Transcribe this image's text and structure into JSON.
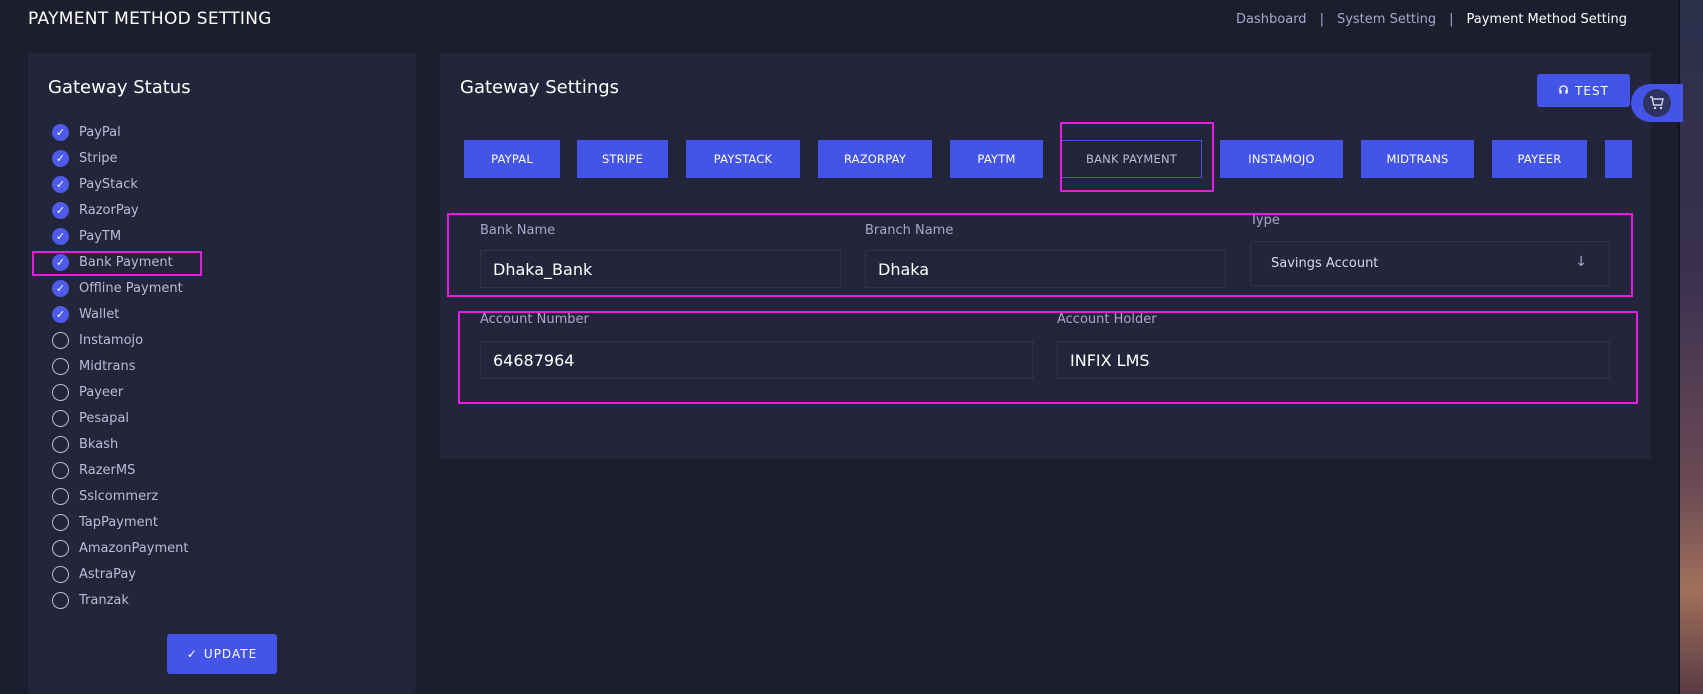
{
  "header": {
    "title": "PAYMENT METHOD SETTING",
    "breadcrumb": [
      "Dashboard",
      "System Setting",
      "Payment Method Setting"
    ],
    "separator": "|"
  },
  "gateway_status": {
    "title": "Gateway Status",
    "items": [
      {
        "label": "PayPal",
        "checked": true
      },
      {
        "label": "Stripe",
        "checked": true
      },
      {
        "label": "PayStack",
        "checked": true
      },
      {
        "label": "RazorPay",
        "checked": true
      },
      {
        "label": "PayTM",
        "checked": true
      },
      {
        "label": "Bank Payment",
        "checked": true
      },
      {
        "label": "Offline Payment",
        "checked": true
      },
      {
        "label": "Wallet",
        "checked": true
      },
      {
        "label": "Instamojo",
        "checked": false
      },
      {
        "label": "Midtrans",
        "checked": false
      },
      {
        "label": "Payeer",
        "checked": false
      },
      {
        "label": "Pesapal",
        "checked": false
      },
      {
        "label": "Bkash",
        "checked": false
      },
      {
        "label": "RazerMS",
        "checked": false
      },
      {
        "label": "Sslcommerz",
        "checked": false
      },
      {
        "label": "TapPayment",
        "checked": false
      },
      {
        "label": "AmazonPayment",
        "checked": false
      },
      {
        "label": "AstraPay",
        "checked": false
      },
      {
        "label": "Tranzak",
        "checked": false
      }
    ],
    "update_label": "UPDATE",
    "update_icon": "check-icon"
  },
  "gateway_settings": {
    "title": "Gateway Settings",
    "test_label": "TEST",
    "test_icon": "headset-icon",
    "tabs": [
      {
        "label": "PAYPAL"
      },
      {
        "label": "STRIPE"
      },
      {
        "label": "PAYSTACK"
      },
      {
        "label": "RAZORPAY"
      },
      {
        "label": "PAYTM"
      },
      {
        "label": "BANK PAYMENT",
        "active": true
      },
      {
        "label": "INSTAMOJO"
      },
      {
        "label": "MIDTRANS"
      },
      {
        "label": "PAYEER"
      },
      {
        "label": ""
      }
    ],
    "form": {
      "bank_name_label": "Bank Name",
      "bank_name_value": "Dhaka_Bank",
      "branch_name_label": "Branch Name",
      "branch_name_value": "Dhaka",
      "type_label": "Type",
      "type_value": "Savings Account",
      "account_number_label": "Account Number",
      "account_number_value": "64687964",
      "account_holder_label": "Account Holder",
      "account_holder_value": "INFIX LMS"
    }
  },
  "colors": {
    "background": "#1c1e2e",
    "card": "#23253a",
    "accent": "#4454e6",
    "highlight": "#e31de3"
  }
}
